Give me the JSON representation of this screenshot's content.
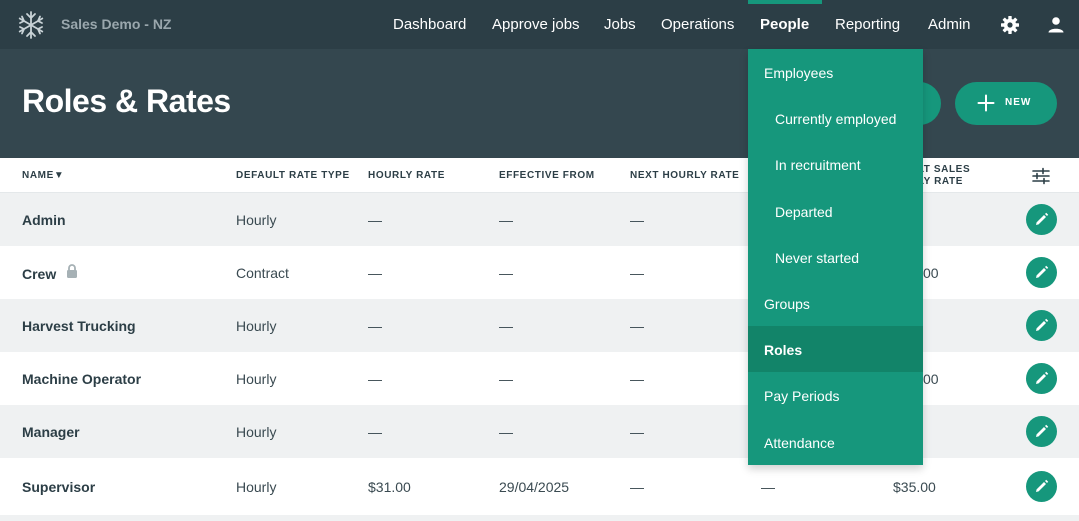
{
  "app": {
    "brand": "Sales Demo - NZ",
    "logo_icon": "snowflake-icon"
  },
  "nav": {
    "items": [
      "Dashboard",
      "Approve jobs",
      "Jobs",
      "Operations",
      "People",
      "Reporting",
      "Admin"
    ],
    "active": "People",
    "settings_icon": "gear-icon",
    "user_icon": "user-icon"
  },
  "page": {
    "title": "Roles & Rates",
    "new_button": "NEW"
  },
  "table": {
    "columns": [
      "NAME▼",
      "DEFAULT RATE TYPE",
      "HOURLY RATE",
      "EFFECTIVE FROM",
      "NEXT HOURLY RATE",
      "ULT SALES",
      "RLY RATE"
    ],
    "rows": [
      {
        "name": "Admin",
        "rate_type": "Hourly",
        "hourly_rate": "—",
        "effective_from": "—",
        "next_hourly_rate": "—",
        "next_eff": "",
        "sales_rate": "",
        "locked": false
      },
      {
        "name": "Crew",
        "rate_type": "Contract",
        "hourly_rate": "—",
        "effective_from": "—",
        "next_hourly_rate": "—",
        "next_eff": "",
        "sales_rate": "00",
        "locked": true
      },
      {
        "name": "Harvest Trucking",
        "rate_type": "Hourly",
        "hourly_rate": "—",
        "effective_from": "—",
        "next_hourly_rate": "—",
        "next_eff": "",
        "sales_rate": "",
        "locked": false
      },
      {
        "name": "Machine Operator",
        "rate_type": "Hourly",
        "hourly_rate": "—",
        "effective_from": "—",
        "next_hourly_rate": "—",
        "next_eff": "",
        "sales_rate": "00",
        "locked": false
      },
      {
        "name": "Manager",
        "rate_type": "Hourly",
        "hourly_rate": "—",
        "effective_from": "—",
        "next_hourly_rate": "—",
        "next_eff": "",
        "sales_rate": "",
        "locked": false
      },
      {
        "name": "Supervisor",
        "rate_type": "Hourly",
        "hourly_rate": "$31.00",
        "effective_from": "29/04/2025",
        "next_hourly_rate": "—",
        "next_eff": "—",
        "sales_rate": "$35.00",
        "locked": false
      }
    ]
  },
  "people_menu": {
    "items": [
      "Employees",
      "Currently employed",
      "In recruitment",
      "Departed",
      "Never started",
      "Groups",
      "Roles",
      "Pay Periods",
      "Attendance"
    ],
    "selected": "Roles"
  },
  "colors": {
    "nav_bg": "#2c3e46",
    "header_bg": "#34474f",
    "accent": "#16977c",
    "menu_selected": "#128469",
    "row_alt": "#eff1f2"
  }
}
